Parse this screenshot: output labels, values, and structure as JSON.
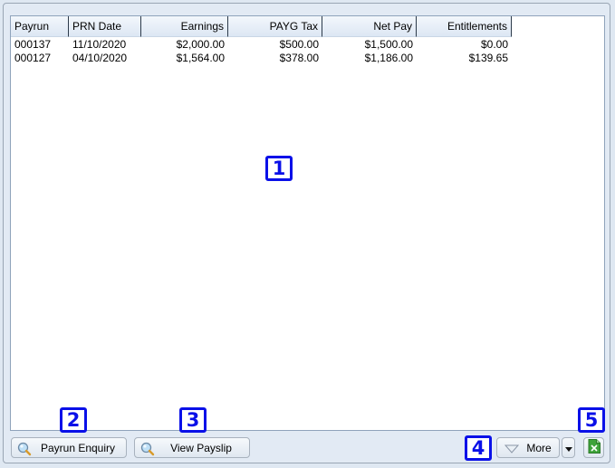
{
  "table": {
    "columns": [
      {
        "label": "Payrun",
        "align": "left"
      },
      {
        "label": "PRN Date",
        "align": "left"
      },
      {
        "label": "Earnings",
        "align": "right"
      },
      {
        "label": "PAYG Tax",
        "align": "right"
      },
      {
        "label": "Net Pay",
        "align": "right"
      },
      {
        "label": "Entitlements",
        "align": "right"
      }
    ],
    "rows": [
      [
        "000137",
        "11/10/2020",
        "$2,000.00",
        "$500.00",
        "$1,500.00",
        "$0.00"
      ],
      [
        "000127",
        "04/10/2020",
        "$1,564.00",
        "$378.00",
        "$1,186.00",
        "$139.65"
      ]
    ]
  },
  "buttons": {
    "payrun_enquiry": "Payrun Enquiry",
    "view_payslip": "View Payslip",
    "more": "More"
  },
  "callouts": [
    "1",
    "2",
    "3",
    "4",
    "5"
  ],
  "icons": {
    "payrun_enquiry": "magnifier-icon",
    "view_payslip": "magnifier-icon",
    "more": "triangle-down-outline-icon",
    "more_dropdown": "caret-down-icon",
    "export": "excel-export-icon"
  },
  "colors": {
    "callout": "#0a10e8",
    "panel_bg": "#e2eaf4",
    "excel_green": "#3ea33a"
  }
}
